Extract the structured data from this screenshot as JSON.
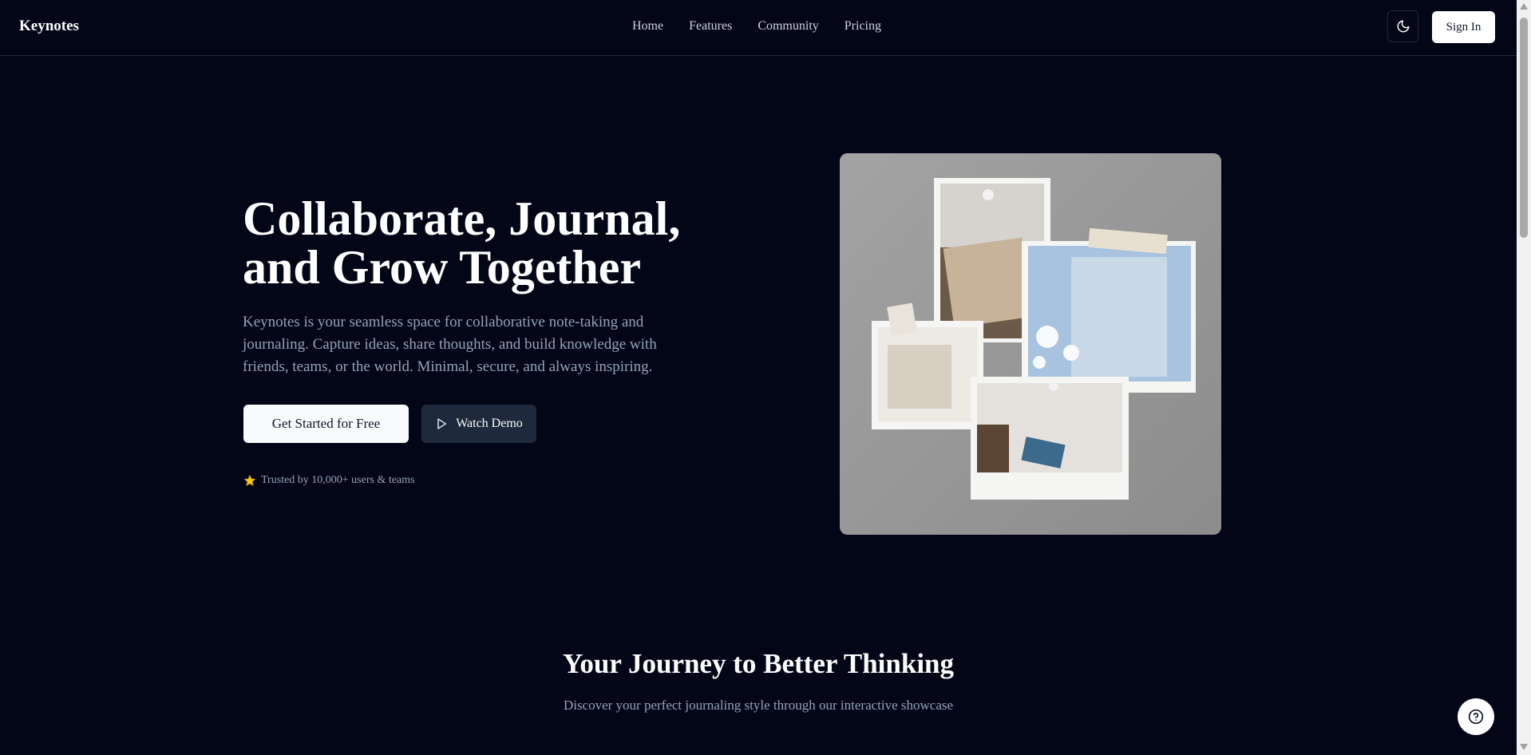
{
  "header": {
    "brand": "Keynotes",
    "nav": [
      "Home",
      "Features",
      "Community",
      "Pricing"
    ],
    "theme_toggle_icon": "moon-icon",
    "sign_in_label": "Sign In"
  },
  "hero": {
    "title_line1": "Collaborate, Journal,",
    "title_line2": "and Grow Together",
    "description": "Keynotes is your seamless space for collaborative note-taking and journaling. Capture ideas, share thoughts, and build knowledge with friends, teams, or the world. Minimal, secure, and always inspiring.",
    "primary_cta": "Get Started for Free",
    "secondary_cta": "Watch Demo",
    "secondary_cta_icon": "play-icon",
    "trusted_icon": "star-icon",
    "trusted_text": "Trusted by 10,000+ users & teams",
    "image_subject": "collage-of-journal-photos"
  },
  "section": {
    "title": "Your Journey to Better Thinking",
    "subtitle": "Discover your perfect journaling style through our interactive showcase"
  },
  "help_icon": "help-icon",
  "colors": {
    "background": "#020617",
    "border": "#1e293b",
    "muted_text": "#94a3b8",
    "button_light": "#f8fafc",
    "button_dark": "#1e293b",
    "star": "#facc15"
  }
}
